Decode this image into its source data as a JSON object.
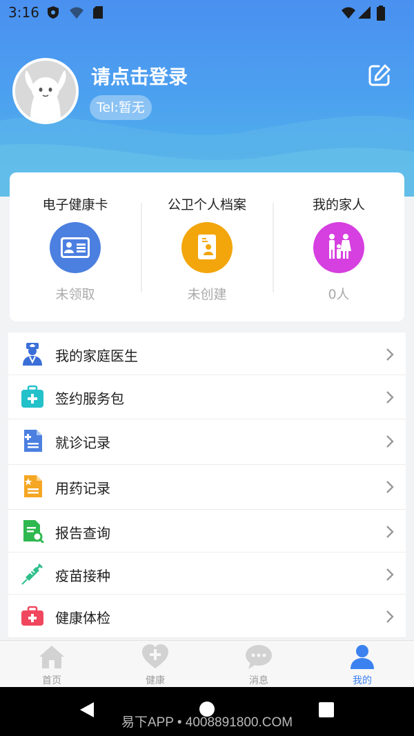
{
  "status_bar": {
    "time": "3:16"
  },
  "profile": {
    "login_text": "请点击登录",
    "tel": "Tel:暂无"
  },
  "cards": [
    {
      "title": "电子健康卡",
      "status": "未领取",
      "color": "#4b7fe0"
    },
    {
      "title": "公卫个人档案",
      "status": "未创建",
      "color": "#f2a60c"
    },
    {
      "title": "我的家人",
      "status": "0人",
      "color": "#d63fe0"
    }
  ],
  "menu": [
    {
      "label": "我的家庭医生",
      "icon": "doctor-icon"
    },
    {
      "label": "签约服务包",
      "icon": "medical-kit-icon"
    },
    {
      "label": "就诊记录",
      "icon": "visit-record-icon"
    },
    {
      "label": "用药记录",
      "icon": "medication-record-icon"
    },
    {
      "label": "报告查询",
      "icon": "report-search-icon"
    },
    {
      "label": "疫苗接种",
      "icon": "syringe-icon"
    },
    {
      "label": "健康体检",
      "icon": "checkup-kit-icon"
    }
  ],
  "tabs": [
    {
      "label": "首页",
      "icon": "home-icon"
    },
    {
      "label": "健康",
      "icon": "health-heart-icon"
    },
    {
      "label": "消息",
      "icon": "message-icon"
    },
    {
      "label": "我的",
      "icon": "profile-icon",
      "active": true
    }
  ],
  "watermark": "易下APP • 4008891800.COM",
  "colors": {
    "accent": "#3b82f0",
    "header_top": "#4a90f0",
    "header_bottom": "#52b8e8"
  }
}
